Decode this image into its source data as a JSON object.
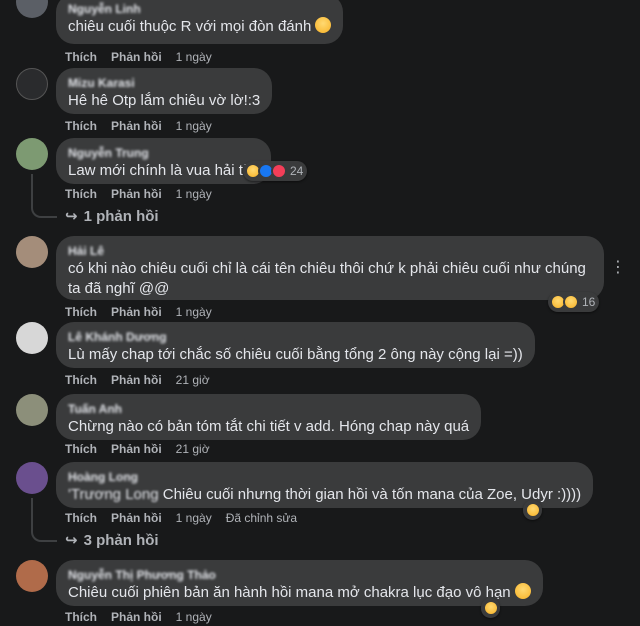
{
  "actions": {
    "like": "Thích",
    "reply": "Phản hồi"
  },
  "comments": [
    {
      "author": "Nguyễn Linh",
      "text": "chiêu cuối thuộc R với mọi đòn đánh",
      "time": "1 ngày",
      "avatar_color": "#5b5f66"
    },
    {
      "author": "Mizu Karasi",
      "text": "Hê hê Otp lắm chiêu vờ lờ!:3",
      "time": "1 ngày",
      "avatar_color": "#2a2b2d"
    },
    {
      "author": "Nguyễn Trung",
      "text": "Law mới chính là vua hải tặc",
      "time": "1 ngày",
      "reaction_count": "24",
      "reply_label": "1 phản hồi",
      "avatar_color": "#7d9a72"
    },
    {
      "author": "Hải Lê",
      "text": "có khi nào chiêu cuối chỉ là cái tên chiêu thôi chứ k phải chiêu cuối như chúng ta đã nghĩ @@",
      "time": "1 ngày",
      "reaction_count": "16",
      "avatar_color": "#a48d7a"
    },
    {
      "author": "Lê Khánh Dương",
      "text": "Lù mấy chap tới chắc số chiêu cuối bằng tổng 2 ông này cộng lại =))",
      "time": "21 giờ",
      "avatar_color": "#d7d7d7"
    },
    {
      "author": "Tuấn Anh",
      "text": "Chừng nào có bản tóm tắt chi tiết v add. Hóng chap này quá",
      "time": "21 giờ",
      "avatar_color": "#8c8f7a"
    },
    {
      "author": "Hoàng Long",
      "tag": "'Trương Long",
      "text": "Chiêu cuối nhưng thời gian hồi và tốn mana của Zoe, Udyr :))))",
      "time": "1 ngày",
      "edited": "Đã chỉnh sửa",
      "reply_label": "3 phản hồi",
      "avatar_color": "#6a4f8e"
    },
    {
      "author": "Nguyễn Thị Phương Thảo",
      "text": "Chiêu cuối phiên bản ăn hành hồi mana mở chakra lục đạo vô hạn",
      "time": "1 ngày",
      "avatar_color": "#b06b4a"
    }
  ]
}
